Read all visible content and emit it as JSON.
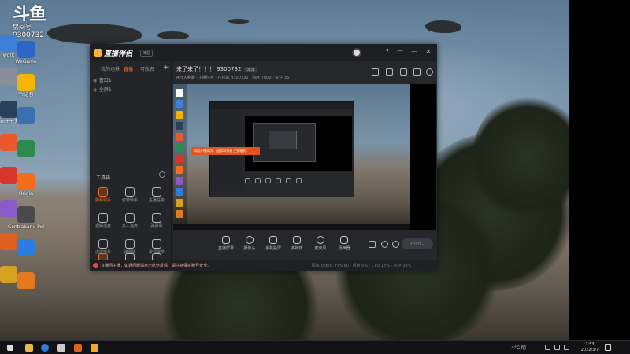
{
  "overlay": {
    "logo_text": "斗鱼",
    "room_label": "房间号",
    "room_number": "9300732"
  },
  "desktop_icons": [
    {
      "label": "work",
      "color": "#3b7fd9"
    },
    {
      "label": "WeGame",
      "color": "#2c66c8"
    },
    {
      "label": "",
      "color": "#888f99"
    },
    {
      "label": "YY语音",
      "color": "#f5b400"
    },
    {
      "label": "steam++ 开代 方式",
      "color": "#2a3f5a"
    },
    {
      "label": "",
      "color": "#3a6fb0"
    },
    {
      "label": "",
      "color": "#e85a2c"
    },
    {
      "label": "",
      "color": "#2d8a4e"
    },
    {
      "label": "",
      "color": "#d9362b"
    },
    {
      "label": "Origin",
      "color": "#f56c1d"
    },
    {
      "label": "",
      "color": "#8a5ac8"
    },
    {
      "label": "Contraband Police Pro...",
      "color": "#4a4a4a"
    },
    {
      "label": "",
      "color": "#e0611f"
    },
    {
      "label": "",
      "color": "#2b7de0"
    },
    {
      "label": "",
      "color": "#d7a21f"
    },
    {
      "label": "",
      "color": "#e37a20"
    }
  ],
  "app": {
    "title": "直播伴侣",
    "badge": "体验",
    "window_controls": [
      "?",
      "▭",
      "—",
      "✕"
    ],
    "tabs": [
      {
        "label": "我的场景",
        "active": false
      },
      {
        "label": "直播",
        "active": true
      },
      {
        "label": "可改名",
        "active": false
      }
    ],
    "add_label": "+",
    "scenes": [
      {
        "label": "窗口1"
      },
      {
        "label": "全屏1"
      }
    ],
    "tools_heading": "工具箱",
    "tools": [
      {
        "label": "弹幕助手",
        "hot": true
      },
      {
        "label": "房管助手",
        "hot": false
      },
      {
        "label": "主播任务",
        "hot": false
      },
      {
        "label": "视频连麦",
        "hot": false
      },
      {
        "label": "多人连麦",
        "hot": false
      },
      {
        "label": "弹弹幕",
        "hot": false
      },
      {
        "label": "虚拟形象",
        "hot": false
      },
      {
        "label": "弹幕墙",
        "hot": false
      },
      {
        "label": "歌词歌单",
        "hot": false
      },
      {
        "label": "",
        "hot": false
      },
      {
        "label": "",
        "hot": false
      },
      {
        "label": "",
        "hot": false
      }
    ],
    "room_title": "来了来了！！！ 9300732",
    "room_tag": "派派",
    "room_meta": "APEX英雄 · 主播任务 · 在线数 9300732 · 热度 7800 · 关注 36",
    "preview_notice": "恭喜开播成功，直播50分钟 主播福利",
    "controls": [
      {
        "label": "直播屏幕"
      },
      {
        "label": "摄像头"
      },
      {
        "label": "手机投屏"
      },
      {
        "label": "多媒体"
      },
      {
        "label": "麦克风"
      },
      {
        "label": "扬声器"
      }
    ],
    "go_live_label": "正在开…",
    "status_text": "直播间主播，如遇问题请点击此处反馈，请注意保护账号安全。",
    "status_stats": "码率 0kb/s · FPS 60 · 丢帧 0% · CPU 18% · 内存 38%"
  },
  "taskbar": {
    "weather": "4°C 阴",
    "time": "7:53",
    "date": "2022/3/7"
  }
}
